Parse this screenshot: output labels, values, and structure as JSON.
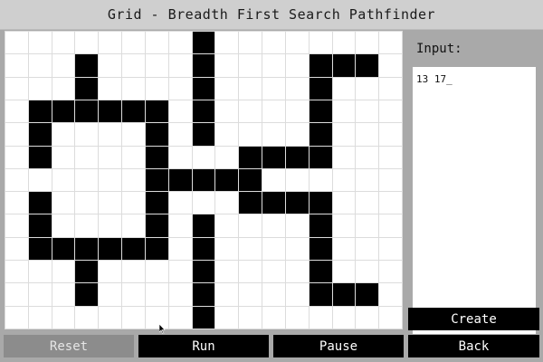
{
  "title": "Grid - Breadth First Search Pathfinder",
  "grid": {
    "rows": 13,
    "cols": 17,
    "walls": [
      [
        0,
        8
      ],
      [
        1,
        3
      ],
      [
        1,
        8
      ],
      [
        1,
        13
      ],
      [
        1,
        14
      ],
      [
        1,
        15
      ],
      [
        2,
        3
      ],
      [
        2,
        8
      ],
      [
        2,
        13
      ],
      [
        3,
        1
      ],
      [
        3,
        2
      ],
      [
        3,
        3
      ],
      [
        3,
        4
      ],
      [
        3,
        5
      ],
      [
        3,
        6
      ],
      [
        3,
        8
      ],
      [
        3,
        13
      ],
      [
        4,
        1
      ],
      [
        4,
        6
      ],
      [
        4,
        8
      ],
      [
        4,
        13
      ],
      [
        5,
        1
      ],
      [
        5,
        6
      ],
      [
        5,
        10
      ],
      [
        5,
        11
      ],
      [
        5,
        12
      ],
      [
        5,
        13
      ],
      [
        6,
        6
      ],
      [
        6,
        7
      ],
      [
        6,
        8
      ],
      [
        6,
        9
      ],
      [
        6,
        10
      ],
      [
        7,
        1
      ],
      [
        7,
        6
      ],
      [
        7,
        10
      ],
      [
        7,
        11
      ],
      [
        7,
        12
      ],
      [
        7,
        13
      ],
      [
        8,
        1
      ],
      [
        8,
        6
      ],
      [
        8,
        8
      ],
      [
        8,
        13
      ],
      [
        9,
        1
      ],
      [
        9,
        2
      ],
      [
        9,
        3
      ],
      [
        9,
        4
      ],
      [
        9,
        5
      ],
      [
        9,
        6
      ],
      [
        9,
        8
      ],
      [
        9,
        13
      ],
      [
        10,
        3
      ],
      [
        10,
        8
      ],
      [
        10,
        13
      ],
      [
        11,
        3
      ],
      [
        11,
        8
      ],
      [
        11,
        13
      ],
      [
        11,
        14
      ],
      [
        11,
        15
      ],
      [
        12,
        8
      ]
    ]
  },
  "panel": {
    "input_label": "Input:",
    "input_value": "13 17_"
  },
  "buttons": {
    "create": "Create",
    "reset": "Reset",
    "run": "Run",
    "pause": "Pause",
    "back": "Back"
  },
  "colors": {
    "wall": "#000000",
    "empty": "#ffffff",
    "button": "#000000",
    "button_disabled": "#8c8c8c"
  },
  "icons": {
    "cursor": "mouse-pointer-icon"
  }
}
